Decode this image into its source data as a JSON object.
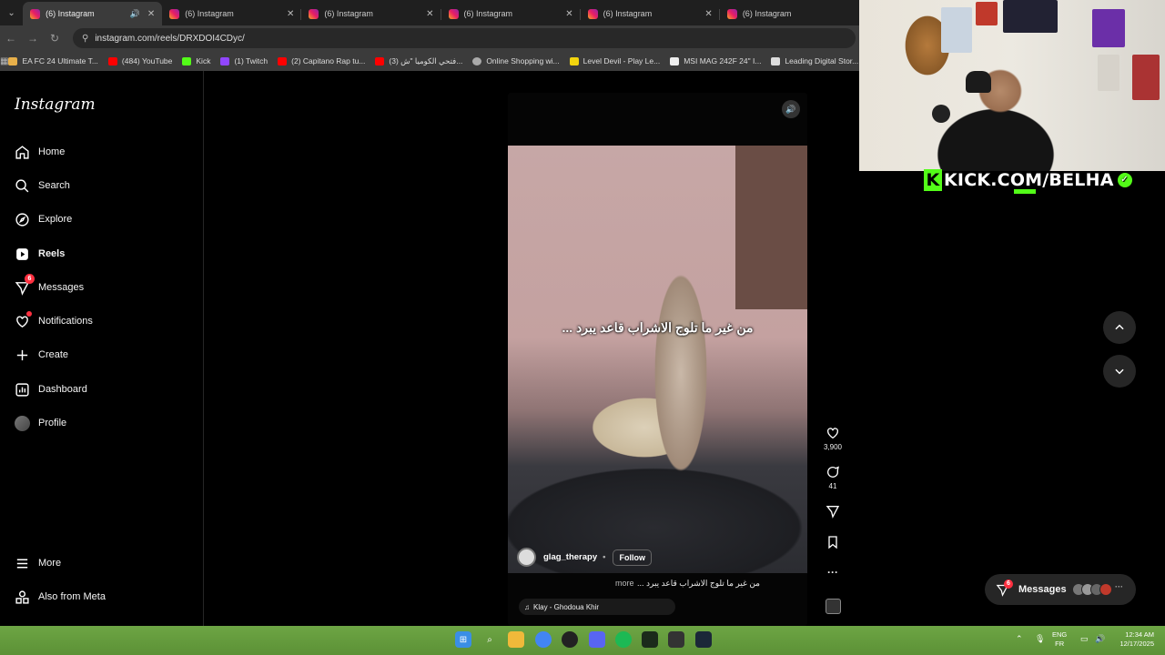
{
  "browser": {
    "tabs": [
      {
        "title": "(6) Instagram",
        "active": true,
        "playing_audio": true
      },
      {
        "title": "(6) Instagram",
        "active": false
      },
      {
        "title": "(6) Instagram",
        "active": false
      },
      {
        "title": "(6) Instagram",
        "active": false
      },
      {
        "title": "(6) Instagram",
        "active": false
      },
      {
        "title": "(6) Instagram",
        "active": false
      }
    ],
    "url": "instagram.com/reels/DRXDOI4CDyc/",
    "bookmarks": [
      {
        "label": "EA FC 24 Ultimate T...",
        "color": "#e8b04a"
      },
      {
        "label": "(484) YouTube",
        "color": "#ff0000"
      },
      {
        "label": "Kick",
        "color": "#53fc18"
      },
      {
        "label": "(1) Twitch",
        "color": "#9146ff"
      },
      {
        "label": "(2) Capitano Rap tu...",
        "color": "#ff0000"
      },
      {
        "label": "(3) فتحي الكوميا \"ش...",
        "color": "#ff0000"
      },
      {
        "label": "Online Shopping wi...",
        "color": "#aaaaaa"
      },
      {
        "label": "Level Devil - Play Le...",
        "color": "#f2d40e"
      },
      {
        "label": "MSI MAG 242F 24\" I...",
        "color": "#eeeeee"
      },
      {
        "label": "Leading Digital Stor...",
        "color": "#dddddd"
      }
    ]
  },
  "instagram": {
    "logo": "Instagram",
    "nav": {
      "home": "Home",
      "search": "Search",
      "explore": "Explore",
      "reels": "Reels",
      "messages": "Messages",
      "messages_badge": "6",
      "notifications": "Notifications",
      "create": "Create",
      "dashboard": "Dashboard",
      "profile": "Profile",
      "more": "More",
      "also_from_meta": "Also from Meta"
    },
    "reel": {
      "overlay_text": "من غير ما تلوج الاشراب قاعد يبرد ...",
      "username": "glag_therapy",
      "follow_label": "Follow",
      "caption": "من غير ما تلوج الاشراب قاعد يبرد ...",
      "more_label": "more",
      "audio": "Klay - Ghodoua Khir",
      "likes": "3,900",
      "comments": "41"
    },
    "messages_pill": {
      "label": "Messages",
      "badge": "6",
      "more": "···"
    }
  },
  "stream_overlay": {
    "channel": "KICK.COM/BELHA",
    "k_glyph": "K",
    "check_glyph": "✓"
  },
  "taskbar": {
    "lang_1": "ENG",
    "lang_2": "FR",
    "time": "12:34 AM",
    "date": "12/17/2025"
  },
  "colors": {
    "kick_green": "#53fc18",
    "ig_notification_red": "#ff3040",
    "taskbar_green": "#5c9136"
  }
}
